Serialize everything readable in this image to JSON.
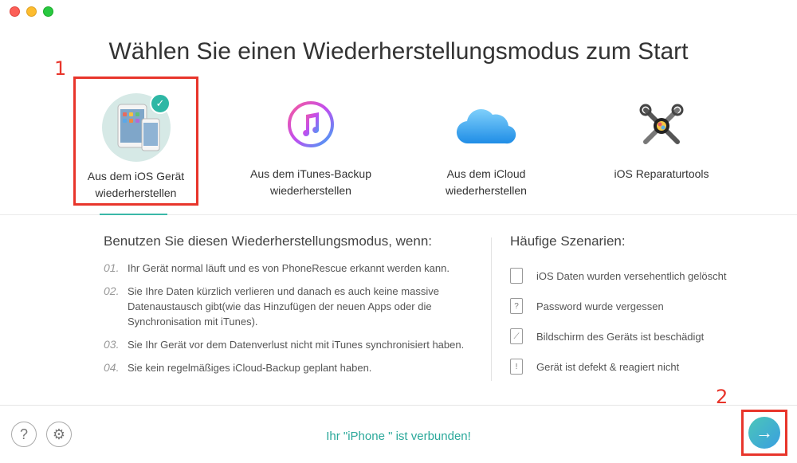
{
  "window": {
    "title": "Wählen Sie einen Wiederherstellungsmodus zum Start"
  },
  "annotations": [
    "1",
    "2"
  ],
  "modes": [
    {
      "label_line1": "Aus dem iOS Gerät",
      "label_line2": "wiederherstellen",
      "icon": "ipad-iphone-icon",
      "selected": true
    },
    {
      "label_line1": "Aus dem iTunes-Backup",
      "label_line2": "wiederherstellen",
      "icon": "itunes-icon",
      "selected": false
    },
    {
      "label_line1": "Aus dem iCloud",
      "label_line2": "wiederherstellen",
      "icon": "icloud-icon",
      "selected": false
    },
    {
      "label_line1": "iOS Reparaturtools",
      "label_line2": "",
      "icon": "repair-tools-icon",
      "selected": false
    }
  ],
  "left_column": {
    "heading": "Benutzen Sie diesen Wiederherstellungsmodus, wenn:",
    "items": [
      {
        "num": "01.",
        "text": "Ihr Gerät normal läuft und es von PhoneRescue erkannt werden kann."
      },
      {
        "num": "02.",
        "text": "Sie Ihre Daten kürzlich verlieren und danach es auch keine massive Datenaustausch gibt(wie das Hinzufügen der neuen Apps oder die Synchronisation mit iTunes)."
      },
      {
        "num": "03.",
        "text": "Sie Ihr Gerät vor dem Datenverlust nicht mit iTunes synchronisiert haben."
      },
      {
        "num": "04.",
        "text": "Sie kein regelmäßiges iCloud-Backup geplant haben."
      }
    ]
  },
  "right_column": {
    "heading": "Häufige Szenarien:",
    "items": [
      {
        "text": "iOS Daten wurden versehentlich gelöscht",
        "icon": "deleted-file-icon",
        "glyph": ""
      },
      {
        "text": "Password wurde vergessen",
        "icon": "password-icon",
        "glyph": "?"
      },
      {
        "text": "Bildschirm des Geräts ist beschädigt",
        "icon": "broken-screen-icon",
        "glyph": "⟋"
      },
      {
        "text": "Gerät ist defekt & reagiert nicht",
        "icon": "device-error-icon",
        "glyph": "!"
      }
    ]
  },
  "footer": {
    "help_glyph": "?",
    "settings_glyph": "⚙",
    "status": "Ihr \"iPhone \" ist verbunden!",
    "next_glyph": "→"
  },
  "colors": {
    "accent": "#2aa89a",
    "annotation_red": "#e8352b"
  }
}
